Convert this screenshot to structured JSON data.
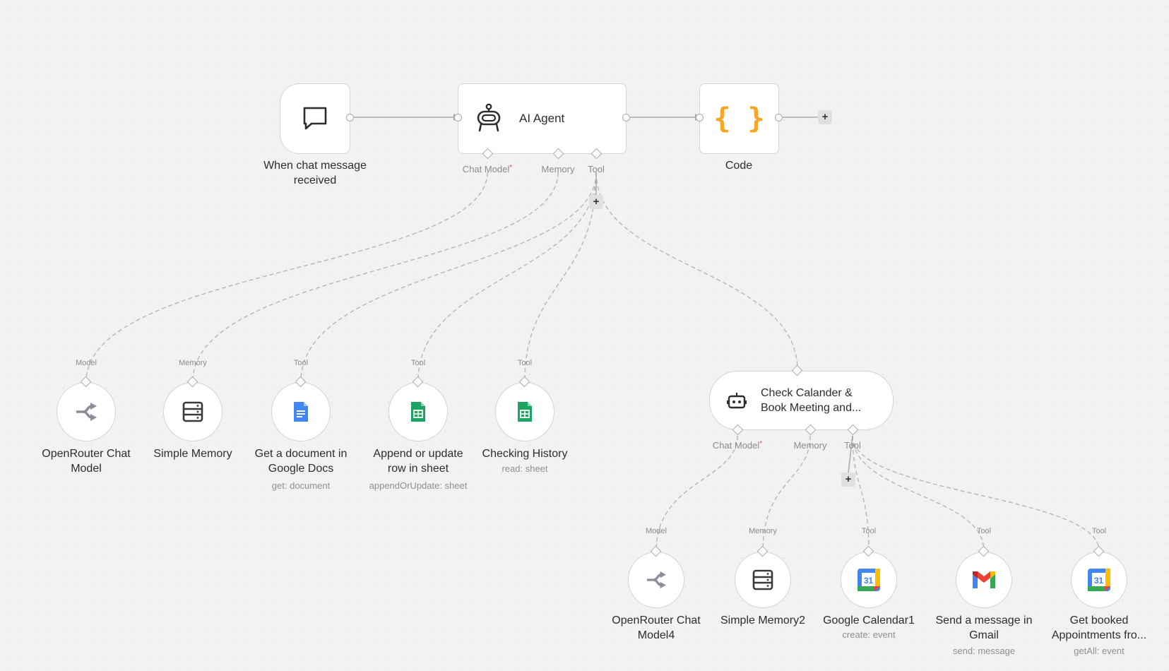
{
  "nodes": {
    "trigger": {
      "label_line1": "When chat message",
      "label_line2": "received",
      "icon": "chat-bubble-icon"
    },
    "agent": {
      "title": "AI Agent",
      "icon": "robot-icon",
      "ports": {
        "chat_model": "Chat Model",
        "memory": "Memory",
        "tool": "Tool"
      }
    },
    "code": {
      "label": "Code",
      "icon": "curly-braces-icon",
      "icon_color": "#f5a623"
    },
    "openrouter1": {
      "port_label": "Model",
      "label_line1": "OpenRouter Chat",
      "label_line2": "Model",
      "icon": "openrouter-icon"
    },
    "memory1": {
      "port_label": "Memory",
      "label": "Simple Memory",
      "icon": "database-icon"
    },
    "gdocs": {
      "port_label": "Tool",
      "label_line1": "Get a document in",
      "label_line2": "Google Docs",
      "sub": "get: document",
      "icon": "google-docs-icon",
      "icon_color": "#4285f4"
    },
    "sheets_append": {
      "port_label": "Tool",
      "label_line1": "Append or update",
      "label_line2": "row in sheet",
      "sub": "appendOrUpdate: sheet",
      "icon": "google-sheets-icon",
      "icon_color": "#1ea362"
    },
    "sheets_history": {
      "port_label": "Tool",
      "label": "Checking History",
      "sub": "read: sheet",
      "icon": "google-sheets-icon",
      "icon_color": "#1ea362"
    },
    "subagent": {
      "title_line1": "Check Calander &",
      "title_line2": "Book Meeting and...",
      "icon": "robot-icon",
      "ports": {
        "chat_model": "Chat Model",
        "memory": "Memory",
        "tool": "Tool"
      }
    },
    "openrouter4": {
      "port_label": "Model",
      "label_line1": "OpenRouter Chat",
      "label_line2": "Model4",
      "icon": "openrouter-icon"
    },
    "memory2": {
      "port_label": "Memory",
      "label": "Simple Memory2",
      "icon": "database-icon"
    },
    "gcal1": {
      "port_label": "Tool",
      "label": "Google Calendar1",
      "sub": "create: event",
      "icon": "google-calendar-icon",
      "day": "31"
    },
    "gmail": {
      "port_label": "Tool",
      "label_line1": "Send a message in",
      "label_line2": "Gmail",
      "sub": "send: message",
      "icon": "gmail-icon"
    },
    "gcal2": {
      "port_label": "Tool",
      "label_line1": "Get booked",
      "label_line2": "Appointments fro...",
      "sub": "getAll: event",
      "icon": "google-calendar-icon",
      "day": "31"
    }
  },
  "add_button": "+"
}
